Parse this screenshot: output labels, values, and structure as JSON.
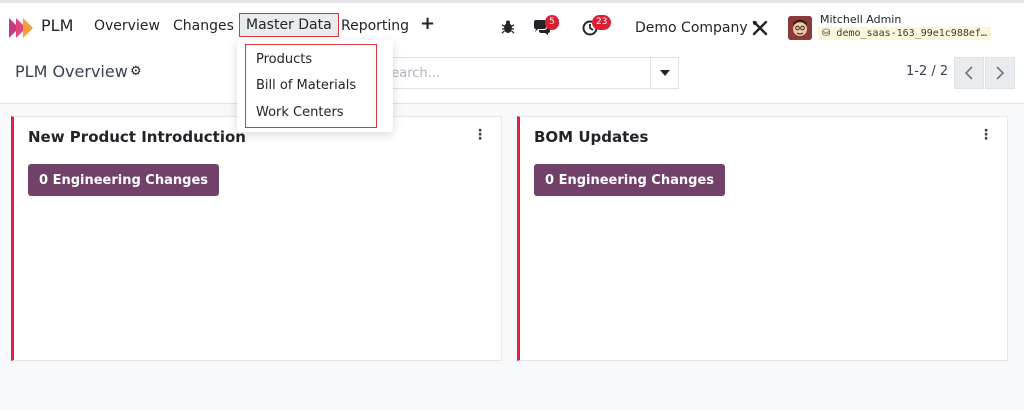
{
  "app": {
    "title": "PLM"
  },
  "menu": {
    "overview": "Overview",
    "changes": "Changes",
    "master_data": "Master Data",
    "reporting": "Reporting",
    "new": "+"
  },
  "systray": {
    "messages_count": "5",
    "activities_count": "23",
    "company": "Demo Company",
    "user_name": "Mitchell Admin",
    "database": "demo_saas-163_99e1c988ef…"
  },
  "control_panel": {
    "title": "PLM Overview",
    "search_placeholder": "Search...",
    "pager": "1-2 / 2"
  },
  "dropdown": {
    "items": [
      "Products",
      "Bill of Materials",
      "Work Centers"
    ]
  },
  "cards": [
    {
      "title": "New Product Introduction",
      "button": "0 Engineering Changes"
    },
    {
      "title": "BOM Updates",
      "button": "0 Engineering Changes"
    }
  ],
  "colors": {
    "accent": "#71416a",
    "card_border": "#e11d48",
    "badge": "#dc1e34",
    "highlight": "#d9383c"
  },
  "icons": [
    "app-logo-icon",
    "bug-icon",
    "chat-icon",
    "activity-clock-icon",
    "tools-icon",
    "gear-icon",
    "caret-down-icon",
    "chevron-left-icon",
    "chevron-right-icon",
    "kebab-icon",
    "database-icon"
  ]
}
